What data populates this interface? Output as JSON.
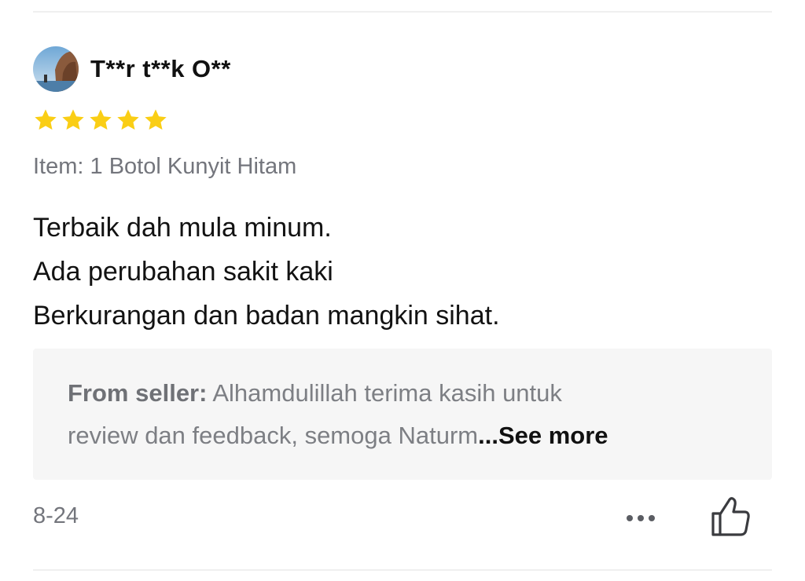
{
  "review": {
    "username": "T**r t**k O**",
    "rating": 5,
    "rating_max": 5,
    "item_line": "Item: 1 Botol Kunyit Hitam",
    "text_lines": [
      "Terbaik dah mula minum.",
      "Ada perubahan sakit kaki",
      "Berkurangan dan badan mangkin sihat."
    ],
    "seller_reply": {
      "label": "From seller:",
      "line1": " Alhamdulillah terima kasih untuk",
      "line2": "review dan feedback, semoga Naturm",
      "see_more": "...See more"
    },
    "date": "8-24",
    "icons": {
      "avatar": "avatar-photo",
      "star": "star-icon",
      "more": "more-dots-icon",
      "like": "thumbs-up-icon"
    }
  },
  "colors": {
    "star": "#FACE15",
    "seller_box_bg": "#F6F6F6",
    "muted_text": "#73757C"
  }
}
